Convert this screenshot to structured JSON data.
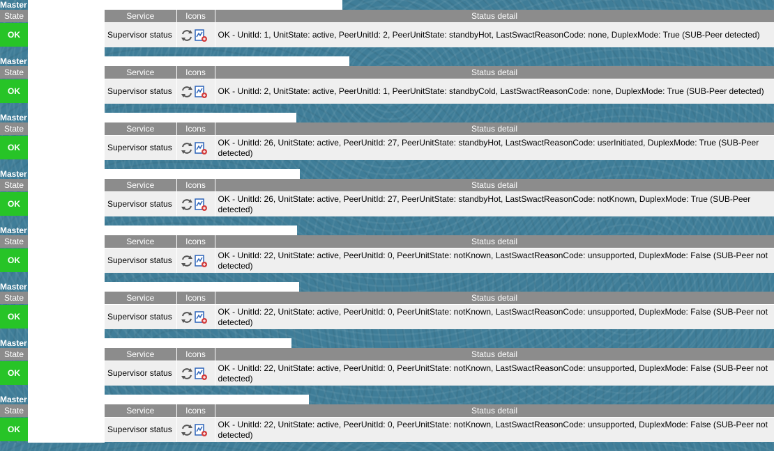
{
  "table_headers": {
    "state": "State",
    "service": "Service",
    "icons": "Icons",
    "status_detail": "Status detail"
  },
  "colors": {
    "header_bg": "#8c8c8c",
    "ok_green": "#27c427",
    "row_bg": "#efefef",
    "background": "#3f7d98"
  },
  "hosts": [
    {
      "master_label": "Master",
      "state": "OK",
      "service": "Supervisor status",
      "icons": [
        "refresh-icon",
        "graph-edit-icon"
      ],
      "status_detail": "OK - UnitId: 1, UnitState: active, PeerUnitId: 2, PeerUnitState: standbyHot, LastSwactReasonCode: none, DuplexMode: True (SUB-Peer detected)"
    },
    {
      "master_label": "Master",
      "state": "OK",
      "service": "Supervisor status",
      "icons": [
        "refresh-icon",
        "graph-edit-icon"
      ],
      "status_detail": "OK - UnitId: 2, UnitState: active, PeerUnitId: 1, PeerUnitState: standbyCold, LastSwactReasonCode: none, DuplexMode: True (SUB-Peer detected)"
    },
    {
      "master_label": "Master",
      "state": "OK",
      "service": "Supervisor status",
      "icons": [
        "refresh-icon",
        "graph-edit-icon"
      ],
      "status_detail": "OK - UnitId: 26, UnitState: active, PeerUnitId: 27, PeerUnitState: standbyHot, LastSwactReasonCode: userInitiated, DuplexMode: True (SUB-Peer detected)"
    },
    {
      "master_label": "Master",
      "state": "OK",
      "service": "Supervisor status",
      "icons": [
        "refresh-icon",
        "graph-edit-icon"
      ],
      "status_detail": "OK - UnitId: 26, UnitState: active, PeerUnitId: 27, PeerUnitState: standbyHot, LastSwactReasonCode: notKnown, DuplexMode: True (SUB-Peer detected)"
    },
    {
      "master_label": "Master",
      "state": "OK",
      "service": "Supervisor status",
      "icons": [
        "refresh-icon",
        "graph-edit-icon"
      ],
      "status_detail": "OK - UnitId: 22, UnitState: active, PeerUnitId: 0, PeerUnitState: notKnown, LastSwactReasonCode: unsupported, DuplexMode: False (SUB-Peer not detected)"
    },
    {
      "master_label": "Master",
      "state": "OK",
      "service": "Supervisor status",
      "icons": [
        "refresh-icon",
        "graph-edit-icon"
      ],
      "status_detail": "OK - UnitId: 22, UnitState: active, PeerUnitId: 0, PeerUnitState: notKnown, LastSwactReasonCode: unsupported, DuplexMode: False (SUB-Peer not detected)"
    },
    {
      "master_label": "Master",
      "state": "OK",
      "service": "Supervisor status",
      "icons": [
        "refresh-icon",
        "graph-edit-icon"
      ],
      "status_detail": "OK - UnitId: 22, UnitState: active, PeerUnitId: 0, PeerUnitState: notKnown, LastSwactReasonCode: unsupported, DuplexMode: False (SUB-Peer not detected)"
    },
    {
      "master_label": "Master",
      "state": "OK",
      "service": "Supervisor status",
      "icons": [
        "refresh-icon",
        "graph-edit-icon"
      ],
      "status_detail": "OK - UnitId: 22, UnitState: active, PeerUnitId: 0, PeerUnitState: notKnown, LastSwactReasonCode: unsupported, DuplexMode: False (SUB-Peer not detected)"
    }
  ]
}
